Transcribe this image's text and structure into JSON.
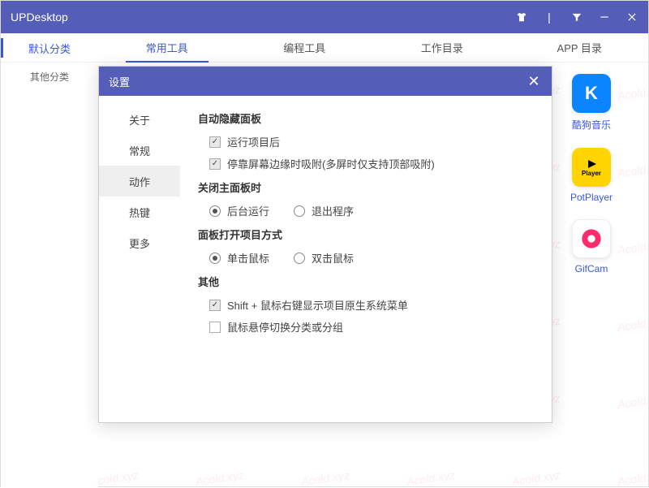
{
  "app": {
    "title": "UPDesktop"
  },
  "watermark": "Acold.xyz",
  "titlebar_icons": [
    "shirt",
    "divider",
    "filter",
    "minimize",
    "close"
  ],
  "sidebar": {
    "items": [
      {
        "label": "默认分类",
        "active": true
      },
      {
        "label": "其他分类",
        "active": false
      }
    ]
  },
  "tabs": {
    "items": [
      {
        "label": "常用工具",
        "active": true
      },
      {
        "label": "编程工具",
        "active": false
      },
      {
        "label": "工作目录",
        "active": false
      },
      {
        "label": "APP 目录",
        "active": false
      }
    ]
  },
  "apps": [
    {
      "name": "酷狗音乐",
      "icon": "kugou"
    },
    {
      "name": "PotPlayer",
      "icon": "potplayer"
    },
    {
      "name": "GifCam",
      "icon": "gifcam"
    }
  ],
  "dialog": {
    "title": "设置",
    "nav": [
      {
        "label": "关于",
        "active": false
      },
      {
        "label": "常规",
        "active": false
      },
      {
        "label": "动作",
        "active": true
      },
      {
        "label": "热键",
        "active": false
      },
      {
        "label": "更多",
        "active": false
      }
    ],
    "sections": {
      "auto_hide": {
        "title": "自动隐藏面板",
        "opts": [
          {
            "type": "checkbox",
            "checked": true,
            "label": "运行项目后"
          },
          {
            "type": "checkbox",
            "checked": true,
            "label": "停靠屏幕边缘时吸附(多屏时仅支持顶部吸附)"
          }
        ]
      },
      "close_panel": {
        "title": "关闭主面板时",
        "opts": [
          {
            "type": "radio",
            "checked": true,
            "label": "后台运行"
          },
          {
            "type": "radio",
            "checked": false,
            "label": "退出程序"
          }
        ]
      },
      "open_mode": {
        "title": "面板打开项目方式",
        "opts": [
          {
            "type": "radio",
            "checked": true,
            "label": "单击鼠标"
          },
          {
            "type": "radio",
            "checked": false,
            "label": "双击鼠标"
          }
        ]
      },
      "other": {
        "title": "其他",
        "opts": [
          {
            "type": "checkbox",
            "checked": true,
            "label": "Shift + 鼠标右键显示项目原生系统菜单"
          },
          {
            "type": "checkbox",
            "checked": false,
            "label": "鼠标悬停切换分类或分组"
          }
        ]
      }
    }
  }
}
